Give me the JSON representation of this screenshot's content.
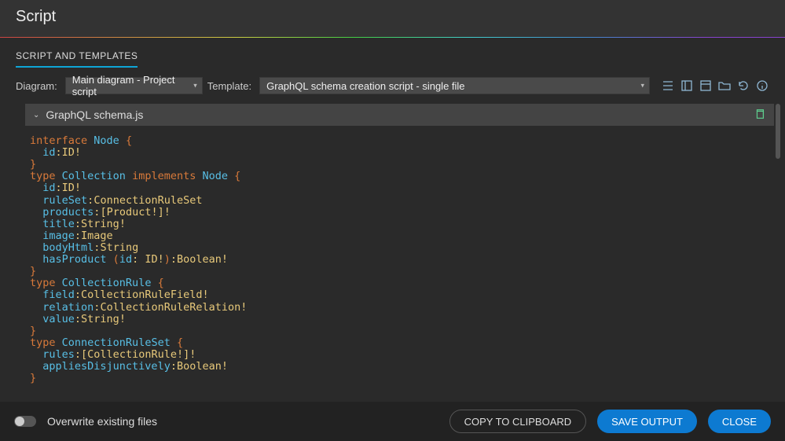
{
  "title": "Script",
  "tabs": {
    "scriptTemplates": "SCRIPT AND TEMPLATES"
  },
  "controls": {
    "diagramLabel": "Diagram:",
    "diagramValue": "Main diagram - Project script",
    "templateLabel": "Template:",
    "templateValue": "GraphQL schema creation script - single file"
  },
  "file": {
    "name": "GraphQL schema.js"
  },
  "code": {
    "lines": [
      [
        [
          "kw",
          "interface"
        ],
        [
          "pl",
          " "
        ],
        [
          "name",
          "Node"
        ],
        [
          "pl",
          " {"
        ]
      ],
      [
        [
          "pl",
          "  "
        ],
        [
          "name",
          "id"
        ],
        [
          "col",
          ":"
        ],
        [
          "ty",
          "ID!"
        ]
      ],
      [
        [
          "pl",
          "}"
        ]
      ],
      [
        [
          "kw",
          "type"
        ],
        [
          "pl",
          " "
        ],
        [
          "name",
          "Collection"
        ],
        [
          "pl",
          " "
        ],
        [
          "kw",
          "implements"
        ],
        [
          "pl",
          " "
        ],
        [
          "name",
          "Node"
        ],
        [
          "pl",
          " {"
        ]
      ],
      [
        [
          "pl",
          "  "
        ],
        [
          "name",
          "id"
        ],
        [
          "col",
          ":"
        ],
        [
          "ty",
          "ID!"
        ]
      ],
      [
        [
          "pl",
          "  "
        ],
        [
          "name",
          "ruleSet"
        ],
        [
          "col",
          ":"
        ],
        [
          "ty",
          "ConnectionRuleSet"
        ]
      ],
      [
        [
          "pl",
          "  "
        ],
        [
          "name",
          "products"
        ],
        [
          "col",
          ":"
        ],
        [
          "ty",
          "[Product!]!"
        ]
      ],
      [
        [
          "pl",
          "  "
        ],
        [
          "name",
          "title"
        ],
        [
          "col",
          ":"
        ],
        [
          "ty",
          "String!"
        ]
      ],
      [
        [
          "pl",
          "  "
        ],
        [
          "name",
          "image"
        ],
        [
          "col",
          ":"
        ],
        [
          "ty",
          "Image"
        ]
      ],
      [
        [
          "pl",
          "  "
        ],
        [
          "name",
          "bodyHtml"
        ],
        [
          "col",
          ":"
        ],
        [
          "ty",
          "String"
        ]
      ],
      [
        [
          "pl",
          "  "
        ],
        [
          "name",
          "hasProduct"
        ],
        [
          "pl",
          " ("
        ],
        [
          "name",
          "id"
        ],
        [
          "col",
          ": "
        ],
        [
          "ty",
          "ID!"
        ],
        [
          "pl",
          ")"
        ],
        [
          "col",
          ":"
        ],
        [
          "ty",
          "Boolean!"
        ]
      ],
      [
        [
          "pl",
          "}"
        ]
      ],
      [
        [
          "kw",
          "type"
        ],
        [
          "pl",
          " "
        ],
        [
          "name",
          "CollectionRule"
        ],
        [
          "pl",
          " {"
        ]
      ],
      [
        [
          "pl",
          "  "
        ],
        [
          "name",
          "field"
        ],
        [
          "col",
          ":"
        ],
        [
          "ty",
          "CollectionRuleField!"
        ]
      ],
      [
        [
          "pl",
          "  "
        ],
        [
          "name",
          "relation"
        ],
        [
          "col",
          ":"
        ],
        [
          "ty",
          "CollectionRuleRelation!"
        ]
      ],
      [
        [
          "pl",
          "  "
        ],
        [
          "name",
          "value"
        ],
        [
          "col",
          ":"
        ],
        [
          "ty",
          "String!"
        ]
      ],
      [
        [
          "pl",
          "}"
        ]
      ],
      [
        [
          "kw",
          "type"
        ],
        [
          "pl",
          " "
        ],
        [
          "name",
          "ConnectionRuleSet"
        ],
        [
          "pl",
          " {"
        ]
      ],
      [
        [
          "pl",
          "  "
        ],
        [
          "name",
          "rules"
        ],
        [
          "col",
          ":"
        ],
        [
          "ty",
          "[CollectionRule!]!"
        ]
      ],
      [
        [
          "pl",
          "  "
        ],
        [
          "name",
          "appliesDisjunctively"
        ],
        [
          "col",
          ":"
        ],
        [
          "ty",
          "Boolean!"
        ]
      ],
      [
        [
          "pl",
          "}"
        ]
      ]
    ]
  },
  "footer": {
    "overwriteLabel": "Overwrite existing files",
    "copy": "COPY TO CLIPBOARD",
    "save": "SAVE OUTPUT",
    "close": "CLOSE"
  }
}
